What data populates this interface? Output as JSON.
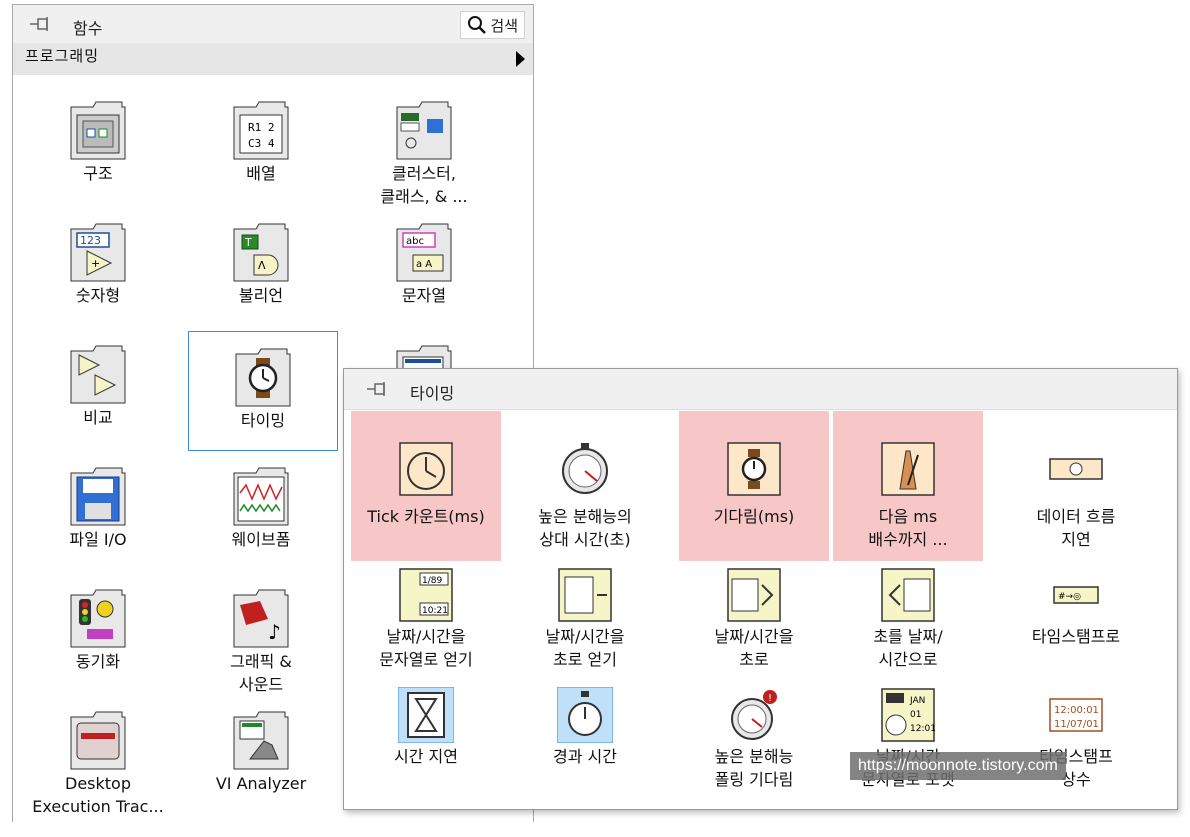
{
  "palette": {
    "title": "함수",
    "search_label": "검색",
    "category": "프로그래밍",
    "items": [
      {
        "label": "구조",
        "icon": "structures-icon"
      },
      {
        "label": "배열",
        "icon": "array-icon"
      },
      {
        "label": "클러스터,\n클래스, & ...",
        "icon": "cluster-icon"
      },
      {
        "label": "숫자형",
        "icon": "numeric-icon"
      },
      {
        "label": "불리언",
        "icon": "boolean-icon"
      },
      {
        "label": "문자열",
        "icon": "string-icon"
      },
      {
        "label": "비교",
        "icon": "comparison-icon"
      },
      {
        "label": "타이밍",
        "icon": "timing-icon"
      },
      {
        "label": "",
        "icon": "dialog-icon"
      },
      {
        "label": "파일 I/O",
        "icon": "file-io-icon"
      },
      {
        "label": "웨이브폼",
        "icon": "waveform-icon"
      },
      {
        "label": "동기화",
        "icon": "synchronization-icon"
      },
      {
        "label": "그래픽 &\n사운드",
        "icon": "graphics-sound-icon"
      },
      {
        "label": "Desktop\nExecution Trac...",
        "icon": "desktop-trace-icon"
      },
      {
        "label": "VI Analyzer",
        "icon": "vi-analyzer-icon"
      }
    ]
  },
  "timing": {
    "title": "타이밍",
    "items": [
      {
        "label": "Tick 카운트(ms)",
        "icon": "tick-count-icon",
        "highlight": true
      },
      {
        "label": "높은 분해능의\n상대 시간(초)",
        "icon": "high-res-stopwatch-icon",
        "highlight": false
      },
      {
        "label": "기다림(ms)",
        "icon": "wait-icon",
        "highlight": true
      },
      {
        "label": "다음 ms\n배수까지 ...",
        "icon": "metronome-icon",
        "highlight": true
      },
      {
        "label": "데이터 흐름\n지연",
        "icon": "dataflow-delay-icon",
        "highlight": false
      },
      {
        "label": "날짜/시간을\n문자열로 얻기",
        "icon": "get-date-time-string-icon"
      },
      {
        "label": "날짜/시간을\n초로 얻기",
        "icon": "get-date-time-seconds-icon"
      },
      {
        "label": "날짜/시간을\n초로",
        "icon": "date-time-to-seconds-icon"
      },
      {
        "label": "초를 날짜/\n시간으로",
        "icon": "seconds-to-date-time-icon"
      },
      {
        "label": "타임스탬프로",
        "icon": "to-timestamp-icon"
      },
      {
        "label": "시간 지연",
        "icon": "time-delay-icon"
      },
      {
        "label": "경과 시간",
        "icon": "elapsed-time-icon"
      },
      {
        "label": "높은 분해능\n폴링 기다림",
        "icon": "high-res-polling-wait-icon"
      },
      {
        "label": "날짜/시간\n문자열로 포맷",
        "icon": "format-date-time-icon"
      },
      {
        "label": "타임스탬프\n상수",
        "icon": "timestamp-constant-icon"
      }
    ]
  },
  "watermark": "https://moonnote.tistory.com",
  "colors": {
    "highlight": "#f7c6c6",
    "selection": "#3b8fd6"
  }
}
